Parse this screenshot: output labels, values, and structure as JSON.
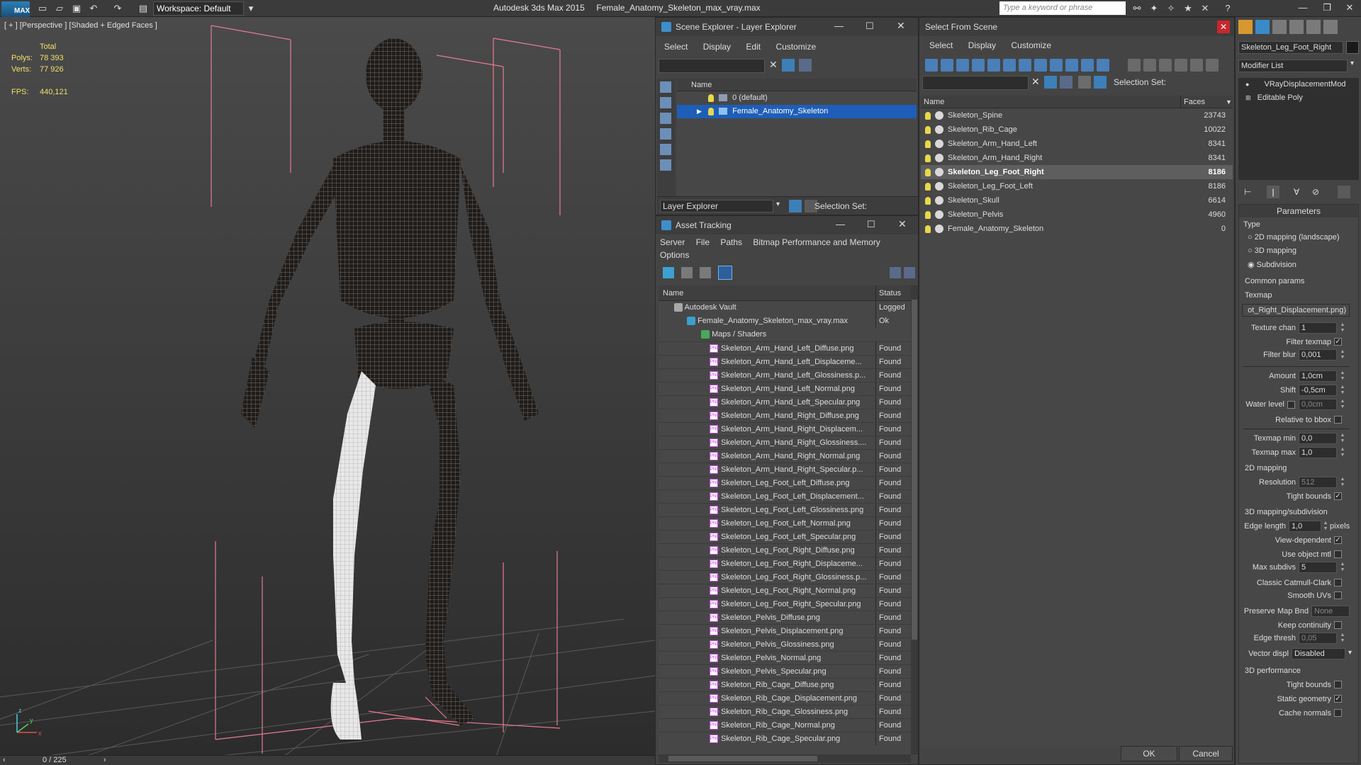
{
  "titlebar": {
    "logo": "MAX",
    "workspace": "Workspace: Default",
    "app_name": "Autodesk 3ds Max  2015",
    "file_name": "Female_Anatomy_Skeleton_max_vray.max",
    "search_placeholder": "Type a keyword or phrase"
  },
  "viewport": {
    "label": "[ + ] [Perspective ] [Shaded + Edged Faces ]",
    "stats_header": "Total",
    "polys_label": "Polys:",
    "polys_value": "78 393",
    "verts_label": "Verts:",
    "verts_value": "77 926",
    "fps_label": "FPS:",
    "fps_value": "440,121",
    "frame_counter": "0 / 225",
    "axis_x": "x",
    "axis_y": "y",
    "axis_z": "z"
  },
  "scene_explorer": {
    "title": "Scene Explorer - Layer Explorer",
    "menu": [
      "Select",
      "Display",
      "Edit",
      "Customize"
    ],
    "col_name": "Name",
    "layers": [
      "0 (default)",
      "Female_Anatomy_Skeleton"
    ],
    "footer_label": "Layer Explorer",
    "selection_set": "Selection Set:"
  },
  "asset_tracking": {
    "title": "Asset Tracking",
    "menu": [
      "Server",
      "File",
      "Paths",
      "Bitmap Performance and Memory"
    ],
    "menu2": "Options",
    "col_name": "Name",
    "col_status": "Status",
    "vault": "Autodesk Vault",
    "vault_status": "Logged",
    "file": "Female_Anatomy_Skeleton_max_vray.max",
    "file_status": "Ok",
    "maps": "Maps / Shaders",
    "assets": [
      "Skeleton_Arm_Hand_Left_Diffuse.png",
      "Skeleton_Arm_Hand_Left_Displaceme...",
      "Skeleton_Arm_Hand_Left_Glossiness.p...",
      "Skeleton_Arm_Hand_Left_Normal.png",
      "Skeleton_Arm_Hand_Left_Specular.png",
      "Skeleton_Arm_Hand_Right_Diffuse.png",
      "Skeleton_Arm_Hand_Right_Displacem...",
      "Skeleton_Arm_Hand_Right_Glossiness....",
      "Skeleton_Arm_Hand_Right_Normal.png",
      "Skeleton_Arm_Hand_Right_Specular.p...",
      "Skeleton_Leg_Foot_Left_Diffuse.png",
      "Skeleton_Leg_Foot_Left_Displacement...",
      "Skeleton_Leg_Foot_Left_Glossiness.png",
      "Skeleton_Leg_Foot_Left_Normal.png",
      "Skeleton_Leg_Foot_Left_Specular.png",
      "Skeleton_Leg_Foot_Right_Diffuse.png",
      "Skeleton_Leg_Foot_Right_Displaceme...",
      "Skeleton_Leg_Foot_Right_Glossiness.p...",
      "Skeleton_Leg_Foot_Right_Normal.png",
      "Skeleton_Leg_Foot_Right_Specular.png",
      "Skeleton_Pelvis_Diffuse.png",
      "Skeleton_Pelvis_Displacement.png",
      "Skeleton_Pelvis_Glossiness.png",
      "Skeleton_Pelvis_Normal.png",
      "Skeleton_Pelvis_Specular.png",
      "Skeleton_Rib_Cage_Diffuse.png",
      "Skeleton_Rib_Cage_Displacement.png",
      "Skeleton_Rib_Cage_Glossiness.png",
      "Skeleton_Rib_Cage_Normal.png",
      "Skeleton_Rib_Cage_Specular.png"
    ],
    "asset_status": "Found"
  },
  "select_scene": {
    "title": "Select From Scene",
    "menu": [
      "Select",
      "Display",
      "Customize"
    ],
    "selection_set": "Selection Set:",
    "col_name": "Name",
    "col_faces": "Faces",
    "objects": [
      {
        "name": "Skeleton_Spine",
        "faces": "23743"
      },
      {
        "name": "Skeleton_Rib_Cage",
        "faces": "10022"
      },
      {
        "name": "Skeleton_Arm_Hand_Left",
        "faces": "8341"
      },
      {
        "name": "Skeleton_Arm_Hand_Right",
        "faces": "8341"
      },
      {
        "name": "Skeleton_Leg_Foot_Right",
        "faces": "8186"
      },
      {
        "name": "Skeleton_Leg_Foot_Left",
        "faces": "8186"
      },
      {
        "name": "Skeleton_Skull",
        "faces": "6614"
      },
      {
        "name": "Skeleton_Pelvis",
        "faces": "4960"
      },
      {
        "name": "Female_Anatomy_Skeleton",
        "faces": "0"
      }
    ],
    "ok": "OK",
    "cancel": "Cancel"
  },
  "modify_panel": {
    "object_name": "Skeleton_Leg_Foot_Right",
    "modifier_list": "Modifier List",
    "stack": [
      "VRayDisplacementMod",
      "Editable Poly"
    ],
    "params_title": "Parameters",
    "type_label": "Type",
    "type_options": [
      "2D mapping (landscape)",
      "3D mapping",
      "Subdivision"
    ],
    "common_params": "Common params",
    "texmap_label": "Texmap",
    "texmap_value": "ot_Right_Displacement.png)",
    "texture_chan_label": "Texture chan",
    "texture_chan_value": "1",
    "filter_texmap": "Filter texmap",
    "filter_blur_label": "Filter blur",
    "filter_blur_value": "0,001",
    "amount_label": "Amount",
    "amount_value": "1,0cm",
    "shift_label": "Shift",
    "shift_value": "-0,5cm",
    "water_label": "Water level",
    "water_value": "0,0cm",
    "relative_bbox": "Relative to bbox",
    "texmap_min_label": "Texmap min",
    "texmap_min_value": "0,0",
    "texmap_max_label": "Texmap max",
    "texmap_max_value": "1,0",
    "mapping2d": "2D mapping",
    "resolution_label": "Resolution",
    "resolution_value": "512",
    "tight_bounds": "Tight bounds",
    "mapping3d": "3D mapping/subdivision",
    "edge_length_label": "Edge length",
    "edge_length_value": "1,0",
    "pixels": "pixels",
    "view_dependent": "View-dependent",
    "use_object_mtl": "Use object mtl",
    "max_subdivs_label": "Max subdivs",
    "max_subdivs_value": "5",
    "catmull": "Classic Catmull-Clark",
    "smooth_uvs": "Smooth UVs",
    "preserve_label": "Preserve Map Bnd",
    "preserve_value": "None",
    "keep_continuity": "Keep continuity",
    "edge_thresh_label": "Edge thresh",
    "edge_thresh_value": "0,05",
    "vector_label": "Vector displ",
    "vector_value": "Disabled",
    "perf3d": "3D performance",
    "tight_bounds2": "Tight bounds",
    "static_geometry": "Static geometry",
    "cache_normals": "Cache normals"
  }
}
